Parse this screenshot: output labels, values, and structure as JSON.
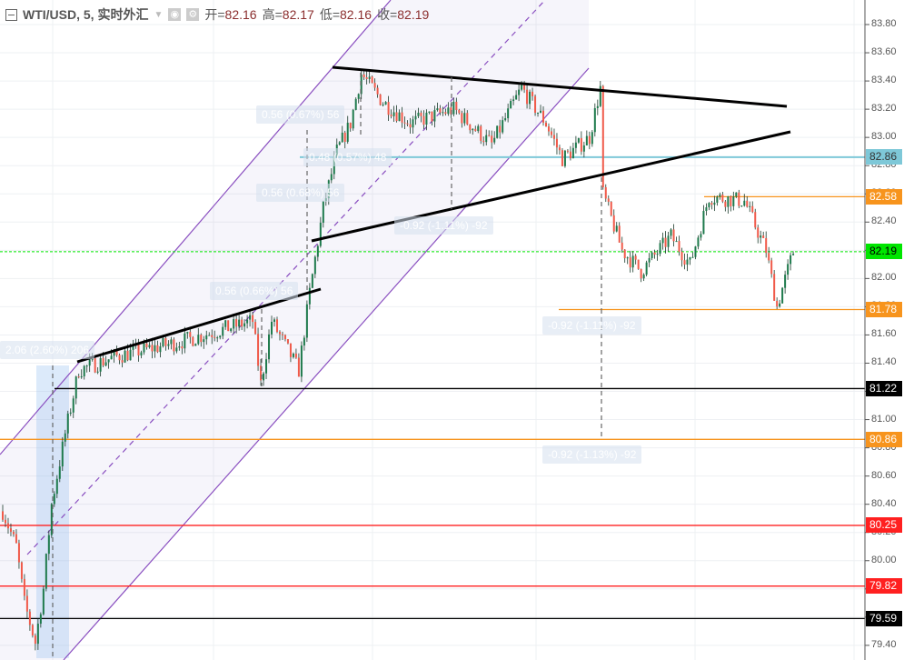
{
  "header": {
    "symbol": "WTI/USD, 5, 实时外汇",
    "open_label": "开=",
    "open": "82.16",
    "high_label": "高=",
    "high": "82.17",
    "low_label": "低=",
    "low": "82.16",
    "close_label": "收=",
    "close": "82.19"
  },
  "chart_data": {
    "type": "candlestick",
    "title": "WTI/USD, 5, 实时外汇",
    "ylim": [
      79.33,
      83.95
    ],
    "y_ticks": [
      "83.80",
      "83.60",
      "83.40",
      "83.20",
      "83.00",
      "82.80",
      "82.60",
      "82.40",
      "82.20",
      "82.00",
      "81.80",
      "81.60",
      "81.40",
      "81.20",
      "81.00",
      "80.80",
      "80.60",
      "80.40",
      "80.20",
      "80.00",
      "79.80",
      "79.60",
      "79.40"
    ],
    "price_path": [
      [
        0,
        80.35
      ],
      [
        5,
        80.1
      ],
      [
        8,
        79.7
      ],
      [
        12,
        79.42
      ],
      [
        15,
        79.8
      ],
      [
        18,
        80.4
      ],
      [
        23,
        80.9
      ],
      [
        28,
        81.35
      ],
      [
        42,
        81.45
      ],
      [
        65,
        81.55
      ],
      [
        92,
        81.7
      ],
      [
        95,
        81.25
      ],
      [
        99,
        81.7
      ],
      [
        109,
        81.35
      ],
      [
        113,
        81.9
      ],
      [
        118,
        82.5
      ],
      [
        123,
        82.9
      ],
      [
        128,
        83.1
      ],
      [
        132,
        83.45
      ],
      [
        140,
        83.25
      ],
      [
        150,
        83.1
      ],
      [
        166,
        83.2
      ],
      [
        180,
        82.95
      ],
      [
        191,
        83.35
      ],
      [
        200,
        83.1
      ],
      [
        206,
        82.85
      ],
      [
        216,
        83.0
      ],
      [
        220,
        83.35
      ],
      [
        221,
        82.6
      ],
      [
        228,
        82.2
      ],
      [
        235,
        82.05
      ],
      [
        246,
        82.3
      ],
      [
        253,
        82.1
      ],
      [
        260,
        82.58
      ],
      [
        273,
        82.55
      ],
      [
        281,
        82.2
      ],
      [
        285,
        81.8
      ],
      [
        291,
        82.19
      ]
    ],
    "levels": [
      {
        "price": "82.86",
        "color": "#7ec8d8",
        "text_color": "#333"
      },
      {
        "price": "82.58",
        "color": "#f7941d",
        "text_color": "#fff"
      },
      {
        "price": "82.19",
        "color": "#00e600",
        "text_color": "#000"
      },
      {
        "price": "81.78",
        "color": "#f7941d",
        "text_color": "#fff"
      },
      {
        "price": "81.22",
        "color": "#000000",
        "text_color": "#fff"
      },
      {
        "price": "80.86",
        "color": "#f7941d",
        "text_color": "#fff"
      },
      {
        "price": "80.25",
        "color": "#ff2020",
        "text_color": "#fff"
      },
      {
        "price": "79.82",
        "color": "#ff2020",
        "text_color": "#fff"
      },
      {
        "price": "79.59",
        "color": "#000000",
        "text_color": "#fff"
      }
    ],
    "measurements": [
      "0.56 (0.67%) 56",
      "0.48 (0.57%) 48",
      "0.56 (0.68%) 56",
      "0.56 (0.66%) 56",
      "2.06 (2.60%) 206",
      "-0.92 (-1.11%) -92",
      "-0.92 (-1.11%) -92",
      "-0.92 (-1.13%) -92"
    ],
    "colors": {
      "up": "#1e7a4c",
      "down": "#f05a4a",
      "channel": "#8a4fc0"
    }
  }
}
